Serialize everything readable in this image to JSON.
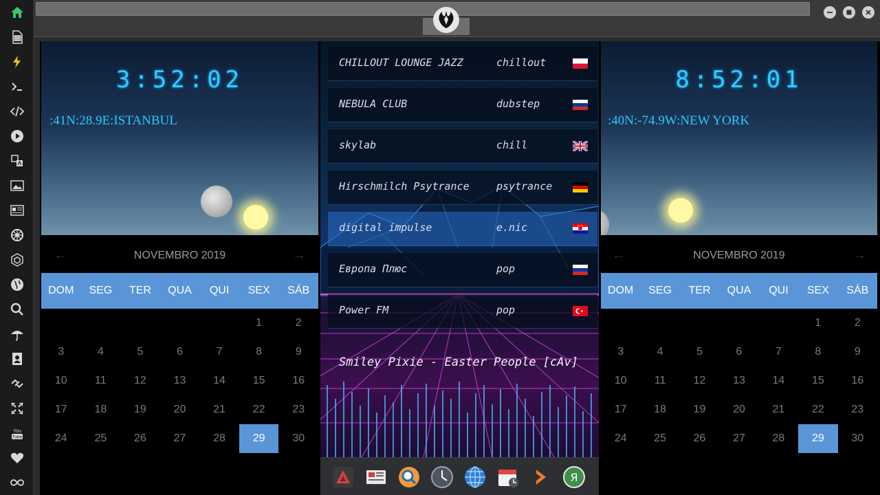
{
  "sidebar": {
    "icons": [
      "home-icon",
      "document-icon",
      "lightning-icon",
      "terminal-icon",
      "code-icon",
      "play-icon",
      "translate-icon",
      "image-icon",
      "news-icon",
      "settings-wheel-icon",
      "hexagon-icon",
      "globe-icon",
      "search-icon",
      "umbrella-icon",
      "contacts-icon",
      "link-icon",
      "fullscreen-icon",
      "youtube-icon",
      "heart-icon",
      "infinity-icon"
    ],
    "youtube_label": "You Tube"
  },
  "left_clock": {
    "time": "3:52:02",
    "location": ":41N:28.9E:ISTANBUL"
  },
  "right_clock": {
    "time": "8:52:01",
    "location": ":40N:-74.9W:NEW YORK"
  },
  "left_calendar": {
    "month": "NOVEMBRO 2019",
    "weekdays": [
      "DOM",
      "SEG",
      "TER",
      "QUA",
      "QUI",
      "SEX",
      "SÁB"
    ],
    "days": [
      "",
      "",
      "",
      "",
      "",
      "1",
      "2",
      "3",
      "4",
      "5",
      "6",
      "7",
      "8",
      "9",
      "10",
      "11",
      "12",
      "13",
      "14",
      "15",
      "16",
      "17",
      "18",
      "19",
      "20",
      "21",
      "22",
      "23",
      "24",
      "25",
      "26",
      "27",
      "28",
      "29",
      "30"
    ],
    "today": "29"
  },
  "right_calendar": {
    "month": "NOVEMBRO 2019",
    "weekdays": [
      "DOM",
      "SEG",
      "TER",
      "QUA",
      "QUI",
      "SEX",
      "SÁB"
    ],
    "days": [
      "",
      "",
      "",
      "",
      "",
      "1",
      "2",
      "3",
      "4",
      "5",
      "6",
      "7",
      "8",
      "9",
      "10",
      "11",
      "12",
      "13",
      "14",
      "15",
      "16",
      "17",
      "18",
      "19",
      "20",
      "21",
      "22",
      "23",
      "24",
      "25",
      "26",
      "27",
      "28",
      "29",
      "30"
    ],
    "today": "29"
  },
  "stations": [
    {
      "name": "CHILLOUT LOUNGE JAZZ",
      "genre": "chillout",
      "flag": "poland"
    },
    {
      "name": "NEBULA CLUB",
      "genre": "dubstep",
      "flag": "russia"
    },
    {
      "name": "skylab",
      "genre": "chill",
      "flag": "uk"
    },
    {
      "name": "Hirschmilch Psytrance",
      "genre": "psytrance",
      "flag": "germany"
    },
    {
      "name": "digital impulse",
      "genre": "e.nic",
      "flag": "croatia"
    },
    {
      "name": "Европа Плюс",
      "genre": "pop",
      "flag": "russia"
    },
    {
      "name": "Power FM",
      "genre": "pop",
      "flag": "turkey"
    }
  ],
  "active_station": "digital impulse",
  "now_playing": "Smiley Pixie - Easter People [cAv]",
  "dock": [
    "app-launcher-icon",
    "news-reader-icon",
    "search-app-icon",
    "clock-app-icon",
    "browser-globe-icon",
    "calendar-app-icon",
    "arrow-app-icon",
    "yandex-icon"
  ],
  "yandex_glyph": "Я",
  "colors": {
    "accent": "#5a95d8",
    "clock_text": "#33ccff"
  }
}
